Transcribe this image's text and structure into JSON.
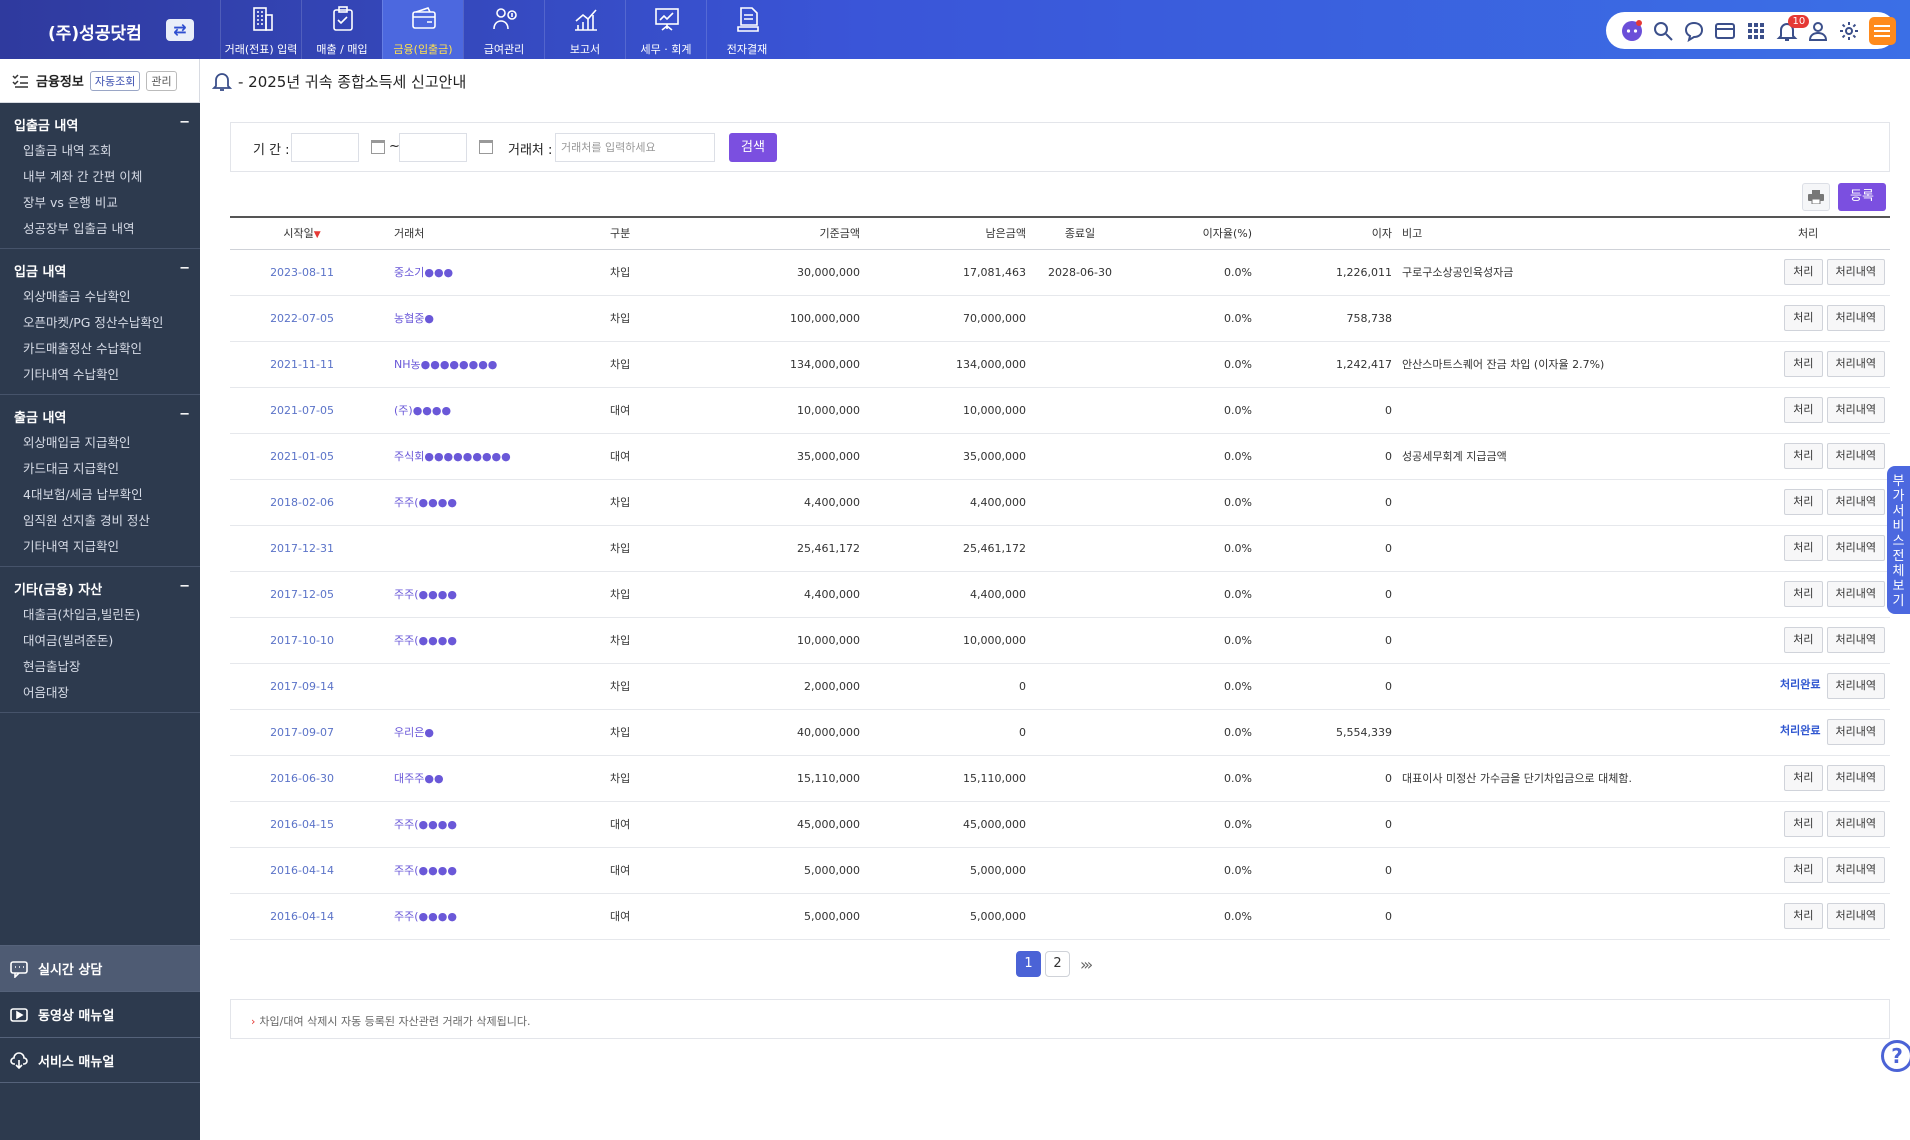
{
  "brand": {
    "name": "(주)성공닷컴",
    "swap_icon": "⇄"
  },
  "topnav": [
    {
      "label": "거래(전표) 입력",
      "icon": "building-icon",
      "active": false
    },
    {
      "label": "매출 / 매입",
      "icon": "clipboard-check-icon",
      "active": false
    },
    {
      "label": "금융(입출금)",
      "icon": "wallet-icon",
      "active": true
    },
    {
      "label": "급여관리",
      "icon": "payroll-icon",
      "active": false
    },
    {
      "label": "보고서",
      "icon": "chart-up-icon",
      "active": false
    },
    {
      "label": "세무 · 회계",
      "icon": "presentation-icon",
      "active": false
    },
    {
      "label": "전자결재",
      "icon": "document-stack-icon",
      "active": false
    }
  ],
  "toolbar": {
    "notification_count": "10"
  },
  "sidebar": {
    "header": {
      "title": "금융정보",
      "chip_auto": "자동조회",
      "chip_manage": "관리"
    },
    "sections": [
      {
        "title": "입출금 내역",
        "items": [
          "입출금 내역 조회",
          "내부 계좌 간 간편 이체",
          "장부 vs 은행 비교",
          "성공장부 입출금 내역"
        ]
      },
      {
        "title": "입금 내역",
        "items": [
          "외상매출금 수납확인",
          "오픈마켓/PG 정산수납확인",
          "카드매출정산 수납확인",
          "기타내역 수납확인"
        ]
      },
      {
        "title": "출금 내역",
        "items": [
          "외상매입금 지급확인",
          "카드대금 지급확인",
          "4대보험/세금 납부확인",
          "임직원 선지출 경비 정산",
          "기타내역 지급확인"
        ]
      },
      {
        "title": "기타(금융) 자산",
        "items": [
          "대출금(차입금,빌린돈)",
          "대여금(빌려준돈)",
          "현금출납장",
          "어음대장"
        ]
      }
    ],
    "collapse_symbol": "−",
    "bottom": {
      "live": "실시간 상담",
      "video": "동영상 매뉴얼",
      "service": "서비스 매뉴얼"
    }
  },
  "notice": {
    "text": "- 2025년 귀속 종합소득세 신고안내"
  },
  "search": {
    "period_label": "기 간 :",
    "tilde": "~",
    "party_label": "거래처 :",
    "party_placeholder": "거래처를 입력하세요",
    "button": "검색"
  },
  "actions": {
    "register": "등록"
  },
  "table": {
    "headers": {
      "start": "시작일",
      "sort": "▼",
      "party": "거래처",
      "type": "구분",
      "base": "기준금액",
      "remain": "남은금액",
      "end": "종료일",
      "rate": "이자율(%)",
      "interest": "이자",
      "note": "비고",
      "action": "처리"
    },
    "btn_process": "처리",
    "btn_history": "처리내역",
    "btn_done": "처리완료",
    "rows": [
      {
        "start": "2023-08-11",
        "party": "중소기●●●",
        "type": "차입",
        "base": "30,000,000",
        "remain": "17,081,463",
        "end": "2028-06-30",
        "rate": "0.0%",
        "interest": "1,226,011",
        "note": "구로구소상공인육성자금",
        "done": false
      },
      {
        "start": "2022-07-05",
        "party": "농협중●",
        "type": "차입",
        "base": "100,000,000",
        "remain": "70,000,000",
        "end": "",
        "rate": "0.0%",
        "interest": "758,738",
        "note": "",
        "done": false
      },
      {
        "start": "2021-11-11",
        "party": "NH농●●●●●●●●",
        "type": "차입",
        "base": "134,000,000",
        "remain": "134,000,000",
        "end": "",
        "rate": "0.0%",
        "interest": "1,242,417",
        "note": "안산스마트스퀘어 잔금 차입 (이자율 2.7%)",
        "done": false
      },
      {
        "start": "2021-07-05",
        "party": "(주)●●●●",
        "type": "대여",
        "base": "10,000,000",
        "remain": "10,000,000",
        "end": "",
        "rate": "0.0%",
        "interest": "0",
        "note": "",
        "done": false
      },
      {
        "start": "2021-01-05",
        "party": "주식회●●●●●●●●●",
        "type": "대여",
        "base": "35,000,000",
        "remain": "35,000,000",
        "end": "",
        "rate": "0.0%",
        "interest": "0",
        "note": "성공세무회계 지급금액",
        "done": false
      },
      {
        "start": "2018-02-06",
        "party": "주주(●●●●",
        "type": "차입",
        "base": "4,400,000",
        "remain": "4,400,000",
        "end": "",
        "rate": "0.0%",
        "interest": "0",
        "note": "",
        "done": false
      },
      {
        "start": "2017-12-31",
        "party": "",
        "type": "차입",
        "base": "25,461,172",
        "remain": "25,461,172",
        "end": "",
        "rate": "0.0%",
        "interest": "0",
        "note": "",
        "done": false
      },
      {
        "start": "2017-12-05",
        "party": "주주(●●●●",
        "type": "차입",
        "base": "4,400,000",
        "remain": "4,400,000",
        "end": "",
        "rate": "0.0%",
        "interest": "0",
        "note": "",
        "done": false
      },
      {
        "start": "2017-10-10",
        "party": "주주(●●●●",
        "type": "차입",
        "base": "10,000,000",
        "remain": "10,000,000",
        "end": "",
        "rate": "0.0%",
        "interest": "0",
        "note": "",
        "done": false
      },
      {
        "start": "2017-09-14",
        "party": "",
        "type": "차입",
        "base": "2,000,000",
        "remain": "0",
        "end": "",
        "rate": "0.0%",
        "interest": "0",
        "note": "",
        "done": true
      },
      {
        "start": "2017-09-07",
        "party": "우리은●",
        "type": "차입",
        "base": "40,000,000",
        "remain": "0",
        "end": "",
        "rate": "0.0%",
        "interest": "5,554,339",
        "note": "",
        "done": true
      },
      {
        "start": "2016-06-30",
        "party": "대주주●●",
        "type": "차입",
        "base": "15,110,000",
        "remain": "15,110,000",
        "end": "",
        "rate": "0.0%",
        "interest": "0",
        "note": "대표이사 미정산 가수금을 단기차입금으로 대체함.",
        "done": false
      },
      {
        "start": "2016-04-15",
        "party": "주주(●●●●",
        "type": "대여",
        "base": "45,000,000",
        "remain": "45,000,000",
        "end": "",
        "rate": "0.0%",
        "interest": "0",
        "note": "",
        "done": false
      },
      {
        "start": "2016-04-14",
        "party": "주주(●●●●",
        "type": "대여",
        "base": "5,000,000",
        "remain": "5,000,000",
        "end": "",
        "rate": "0.0%",
        "interest": "0",
        "note": "",
        "done": false
      },
      {
        "start": "2016-04-14",
        "party": "주주(●●●●",
        "type": "대여",
        "base": "5,000,000",
        "remain": "5,000,000",
        "end": "",
        "rate": "0.0%",
        "interest": "0",
        "note": "",
        "done": false
      }
    ]
  },
  "pagination": {
    "pages": [
      "1",
      "2"
    ],
    "current": "1",
    "next": "›»"
  },
  "footnote": {
    "arrow": "›",
    "text": "차입/대여 삭제시 자동 등록된 자산관련 거래가 삭제됩니다."
  },
  "side_tab": {
    "text": "부가서비스 전체보기"
  },
  "help": {
    "text": "?"
  }
}
